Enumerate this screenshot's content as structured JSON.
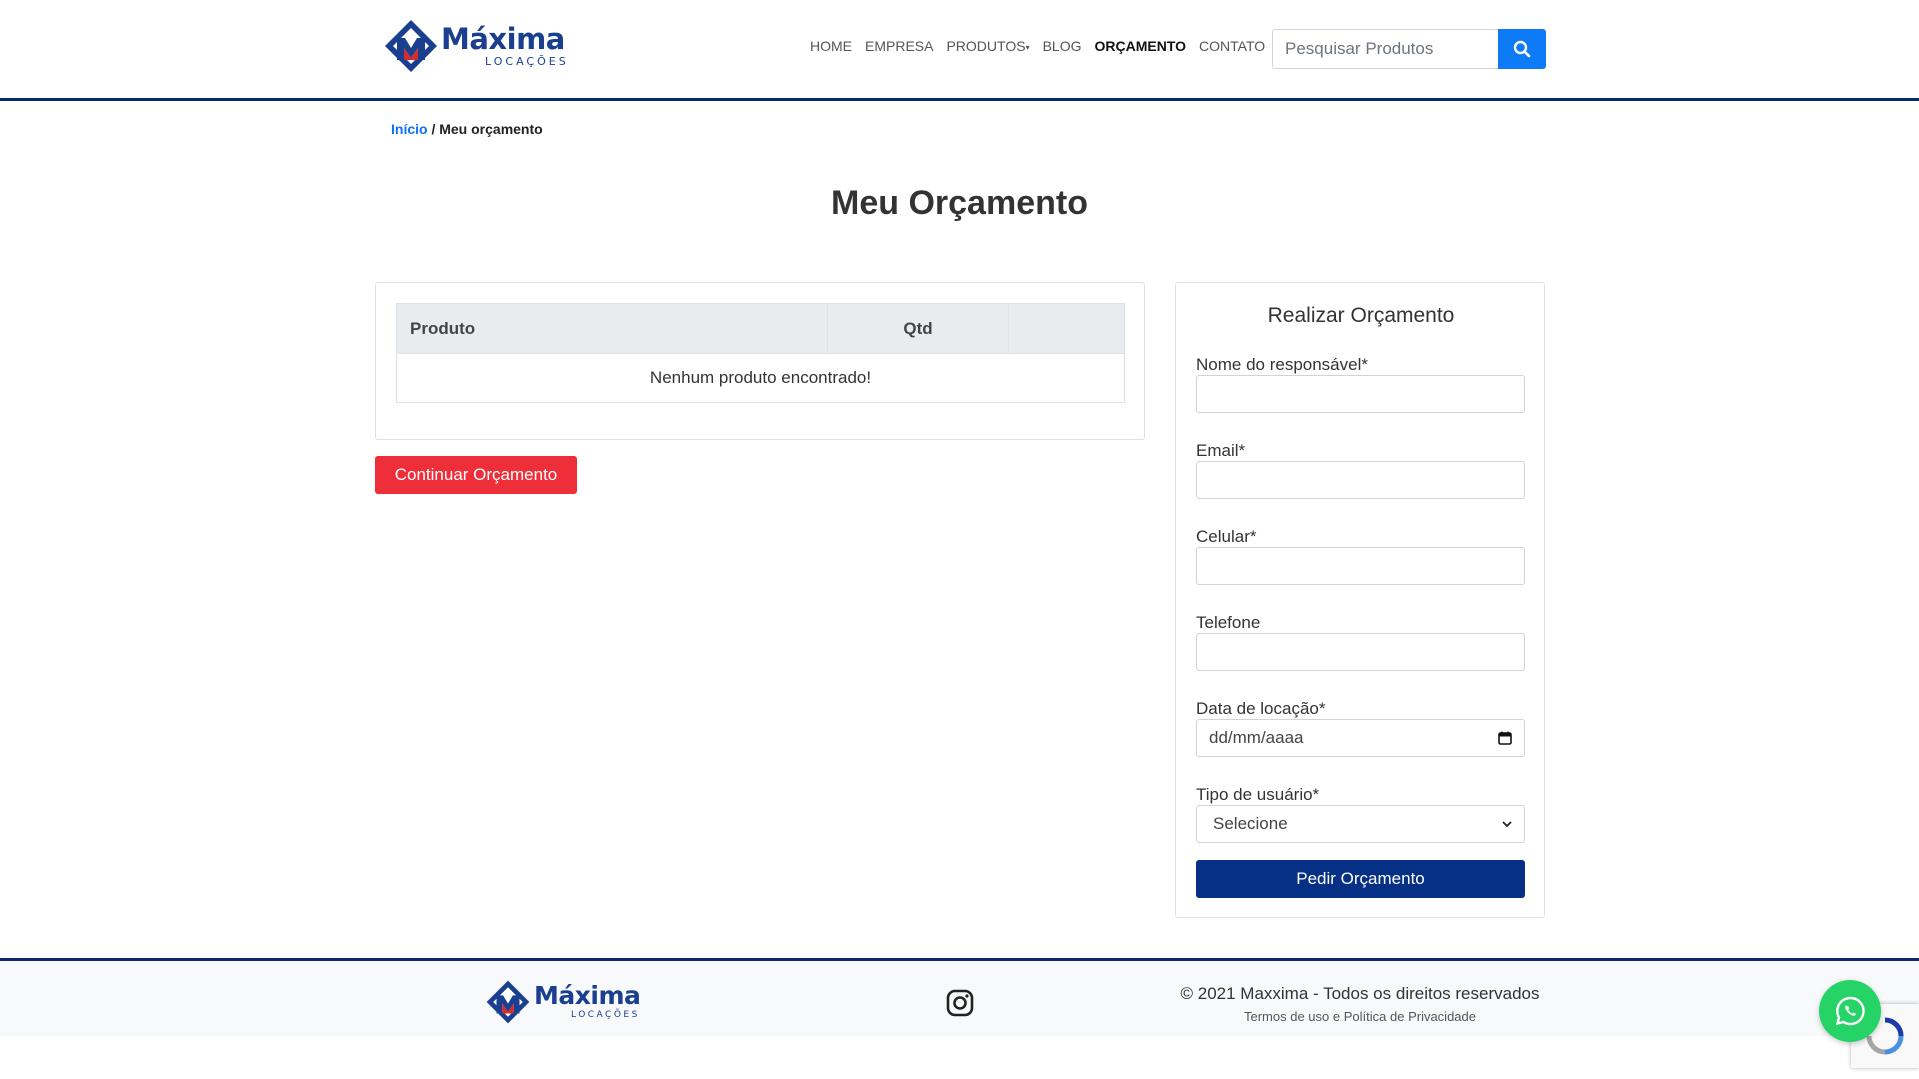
{
  "brand": {
    "name": "Máxima",
    "subtitle": "LOCAÇÕES",
    "colors": {
      "primary": "#1b3f8f",
      "accent_red": "#ee2e38",
      "dark_blue": "#062f86",
      "link_blue": "#0d6efd",
      "search_blue": "#0d7bf7",
      "whatsapp_green": "#25d366"
    }
  },
  "nav": {
    "items": [
      {
        "label": "HOME"
      },
      {
        "label": "EMPRESA"
      },
      {
        "label": "PRODUTOS"
      },
      {
        "label": "BLOG"
      },
      {
        "label": "ORÇAMENTO",
        "active": true
      },
      {
        "label": "CONTATO"
      }
    ],
    "dropdown_caret": "▾"
  },
  "search": {
    "placeholder": "Pesquisar Produtos",
    "icon": "search-icon"
  },
  "breadcrumb": {
    "home": "Início",
    "separator": "/",
    "current": "Meu orçamento"
  },
  "page_title": "Meu Orçamento",
  "cart": {
    "columns": {
      "product": "Produto",
      "qty": "Qtd",
      "actions": ""
    },
    "empty_message": "Nenhum produto encontrado!",
    "continue_label": "Continuar Orçamento"
  },
  "form": {
    "title": "Realizar Orçamento",
    "fields": {
      "name_label": "Nome do responsável*",
      "email_label": "Email*",
      "mobile_label": "Celular*",
      "phone_label": "Telefone",
      "date_label": "Data de locação*",
      "date_placeholder": "dd/mm/aaaa",
      "user_type_label": "Tipo de usuário*",
      "user_type_value": "Selecione"
    },
    "submit_label": "Pedir Orçamento"
  },
  "footer": {
    "copyright": "© 2021 Maxxima - Todos os direitos reservados",
    "terms": "Termos de uso",
    "and": "e",
    "privacy": "Política de Privacidade",
    "social_icon": "instagram-icon"
  },
  "floating": {
    "whatsapp_icon": "whatsapp-icon",
    "recaptcha_icon": "recaptcha-icon"
  }
}
